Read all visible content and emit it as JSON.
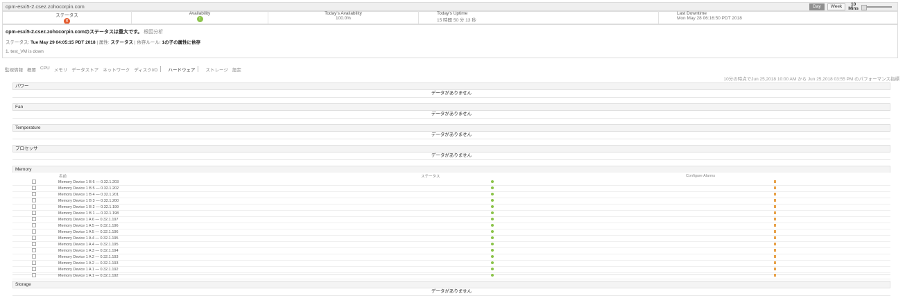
{
  "window": {
    "host": "opm-esxi5-2.csez.zohocorpin.com"
  },
  "period": {
    "buttons": [
      "Day",
      "Week"
    ],
    "mins_value": "10",
    "mins_label": "Mins"
  },
  "summary": {
    "status_label": "ステータス",
    "availability_label": "Availability",
    "todays_availability_label": "Today's Availability",
    "todays_availability_value": "100.0%",
    "todays_uptime_label": "Today's Uptime",
    "todays_uptime_value": "15 時間 50 分 13 秒",
    "last_downtime_label": "Last Downtime",
    "last_downtime_value": "Mon May 28 06:16:50 PDT 2018"
  },
  "info": {
    "monitor_name": "opm-esxi5-2.csez.zohocorpin.com",
    "status_sentence": "のステータスは重大です。",
    "root_cause_link": "根因分析",
    "status_prefix": "ステータス:",
    "timestamp": "Tue May 29 04:05:15 PDT 2018",
    "attribute_label": "属性:",
    "attribute_value": "ステータス",
    "dependent_rule_label": "依存ルール:",
    "dependent_rule_value": "1の子の属性に依存",
    "message": "1. test_VM is down"
  },
  "tabs": [
    "監視情報",
    "概要",
    "CPU",
    "メモリ",
    "データストア",
    "ネットワーク",
    "ディスクI/O",
    "ハードウェア",
    "ストレージ",
    "設定"
  ],
  "active_tab": "ハードウェア",
  "perf_note": "10分の時点でJun 25,2018 10:00 AM から Jun 25,2018 03:55 PM のパフォーマンス指標",
  "panels": [
    {
      "title": "パワー",
      "nodata": "データがありません"
    },
    {
      "title": "Fan",
      "nodata": "データがありません"
    },
    {
      "title": "Temperature",
      "nodata": "データがありません"
    },
    {
      "title": "プロセッサ",
      "nodata": "データがありません"
    }
  ],
  "memory": {
    "title": "Memory",
    "columns": {
      "name": "名前",
      "status": "ステータス",
      "alarms": "Configure Alarms"
    },
    "rows": [
      "Memory Device 1 B 6 — 0.32.1.203",
      "Memory Device 1 B 5 — 0.32.1.202",
      "Memory Device 1 B 4 — 0.32.1.201",
      "Memory Device 1 B 3 — 0.32.1.200",
      "Memory Device 1 B 2 — 0.32.1.199",
      "Memory Device 1 B 1 — 0.32.1.198",
      "Memory Device 1 A 6 — 0.32.1.197",
      "Memory Device 1 A 5 — 0.32.1.196",
      "Memory Device 1 A 5 — 0.32.1.196",
      "Memory Device 1 A 4 — 0.32.1.195",
      "Memory Device 1 A 4 — 0.32.1.195",
      "Memory Device 1 A 3 — 0.32.1.194",
      "Memory Device 1 A 2 — 0.32.1.193",
      "Memory Device 1 A 2 — 0.32.1.193",
      "Memory Device 1 A 1 — 0.32.1.192",
      "Memory Device 1 A 1 — 0.32.1.192"
    ]
  },
  "storage": {
    "title": "Storage",
    "nodata": "データがありません"
  }
}
